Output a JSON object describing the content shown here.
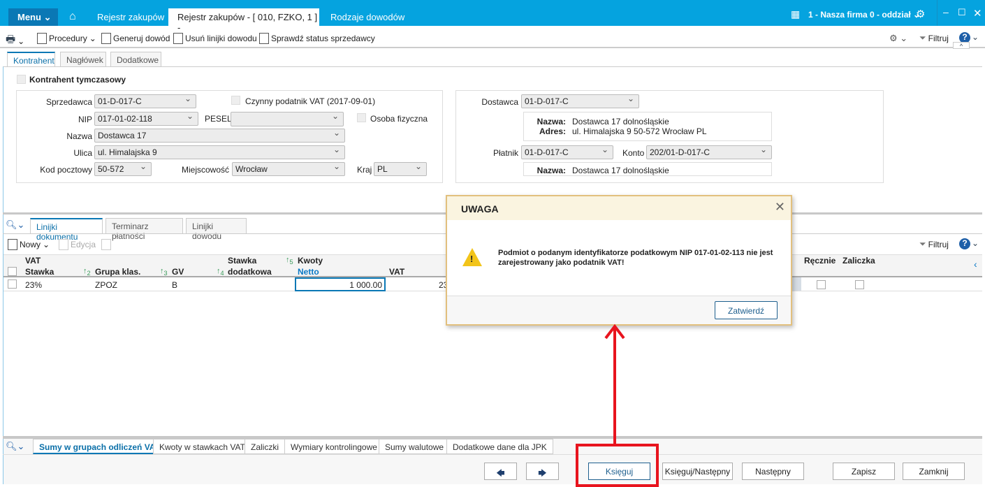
{
  "titlebar": {
    "menu": "Menu",
    "tabs": [
      "Rejestr zakupów",
      "Rejestr zakupów - [ 010, FZKO, 1 ] -",
      "Rodzaje dowodów"
    ],
    "company": "1 - Nasza firma 0 - oddział"
  },
  "toolbar": {
    "procedury": "Procedury",
    "generuj": "Generuj dowód",
    "usun": "Usuń linijki dowodu",
    "sprawdz": "Sprawdź status sprzedawcy",
    "filtruj": "Filtruj"
  },
  "tabs": [
    "Kontrahent",
    "Nagłówek",
    "Dodatkowe"
  ],
  "kontrahent": {
    "tymczasowy": "Kontrahent tymczasowy",
    "sprzedawca_label": "Sprzedawca",
    "sprzedawca": "01-D-017-C",
    "czynny": "Czynny podatnik VAT (2017-09-01)",
    "nip_label": "NIP",
    "nip": "017-01-02-118",
    "pesel_label": "PESEL",
    "pesel": "",
    "osoba": "Osoba fizyczna",
    "nazwa_label": "Nazwa",
    "nazwa": "Dostawca 17",
    "ulica_label": "Ulica",
    "ulica": "ul. Himalajska 9",
    "kod_label": "Kod pocztowy",
    "kod": "50-572",
    "miejscowosc_label": "Miejscowość",
    "miejscowosc": "Wrocław",
    "kraj_label": "Kraj",
    "kraj": "PL"
  },
  "dostawca": {
    "label": "Dostawca",
    "value": "01-D-017-C",
    "nazwa_label": "Nazwa:",
    "nazwa": "Dostawca 17 dolnośląskie",
    "adres_label": "Adres:",
    "adres": "ul. Himalajska 9 50-572 Wrocław PL",
    "platnik_label": "Płatnik",
    "platnik": "01-D-017-C",
    "konto_label": "Konto",
    "konto": "202/01-D-017-C",
    "platnik_nazwa_label": "Nazwa:",
    "platnik_nazwa": "Dostawca 17 dolnośląskie"
  },
  "lower_tabs": [
    "Linijki dokumentu",
    "Terminarz płatności",
    "Linijki dowodu"
  ],
  "lines_toolbar": {
    "nowy": "Nowy",
    "edycja": "Edycja",
    "filtruj": "Filtruj"
  },
  "grid": {
    "group_vat": "VAT",
    "group_kwoty": "Kwoty",
    "columns": {
      "stawka": "Stawka",
      "grupa": "Grupa klas.",
      "gv": "GV",
      "stawka_dod_1": "Stawka",
      "stawka_dod_2": "dodatkowa",
      "netto": "Netto",
      "vat": "VAT",
      "recznie": "Ręcznie",
      "zaliczka": "Zaliczka"
    },
    "sort_numbers": [
      "2",
      "3",
      "4",
      "5"
    ],
    "rows": [
      {
        "stawka": "23%",
        "grupa": "ZPOZ",
        "gv": "B",
        "netto": "1 000.00",
        "vat": "23"
      }
    ]
  },
  "dialog": {
    "title": "UWAGA",
    "message": "Podmiot o podanym identyfikatorze podatkowym NIP 017-01-02-113 nie jest zarejestrowany jako podatnik VAT!",
    "confirm": "Zatwierdź"
  },
  "bottom_tabs": [
    "Sumy w grupach odliczeń VAT",
    "Kwoty w stawkach VAT",
    "Zaliczki",
    "Wymiary kontrolingowe",
    "Sumy walutowe",
    "Dodatkowe dane dla JPK"
  ],
  "buttons": {
    "ksieguj": "Księguj",
    "ksieguj_nastepny": "Księguj/Następny",
    "nastepny": "Następny",
    "zapisz": "Zapisz",
    "zamknij": "Zamknij"
  },
  "colors": {
    "brand": "#05a3df",
    "annotation": "#e8141e"
  }
}
